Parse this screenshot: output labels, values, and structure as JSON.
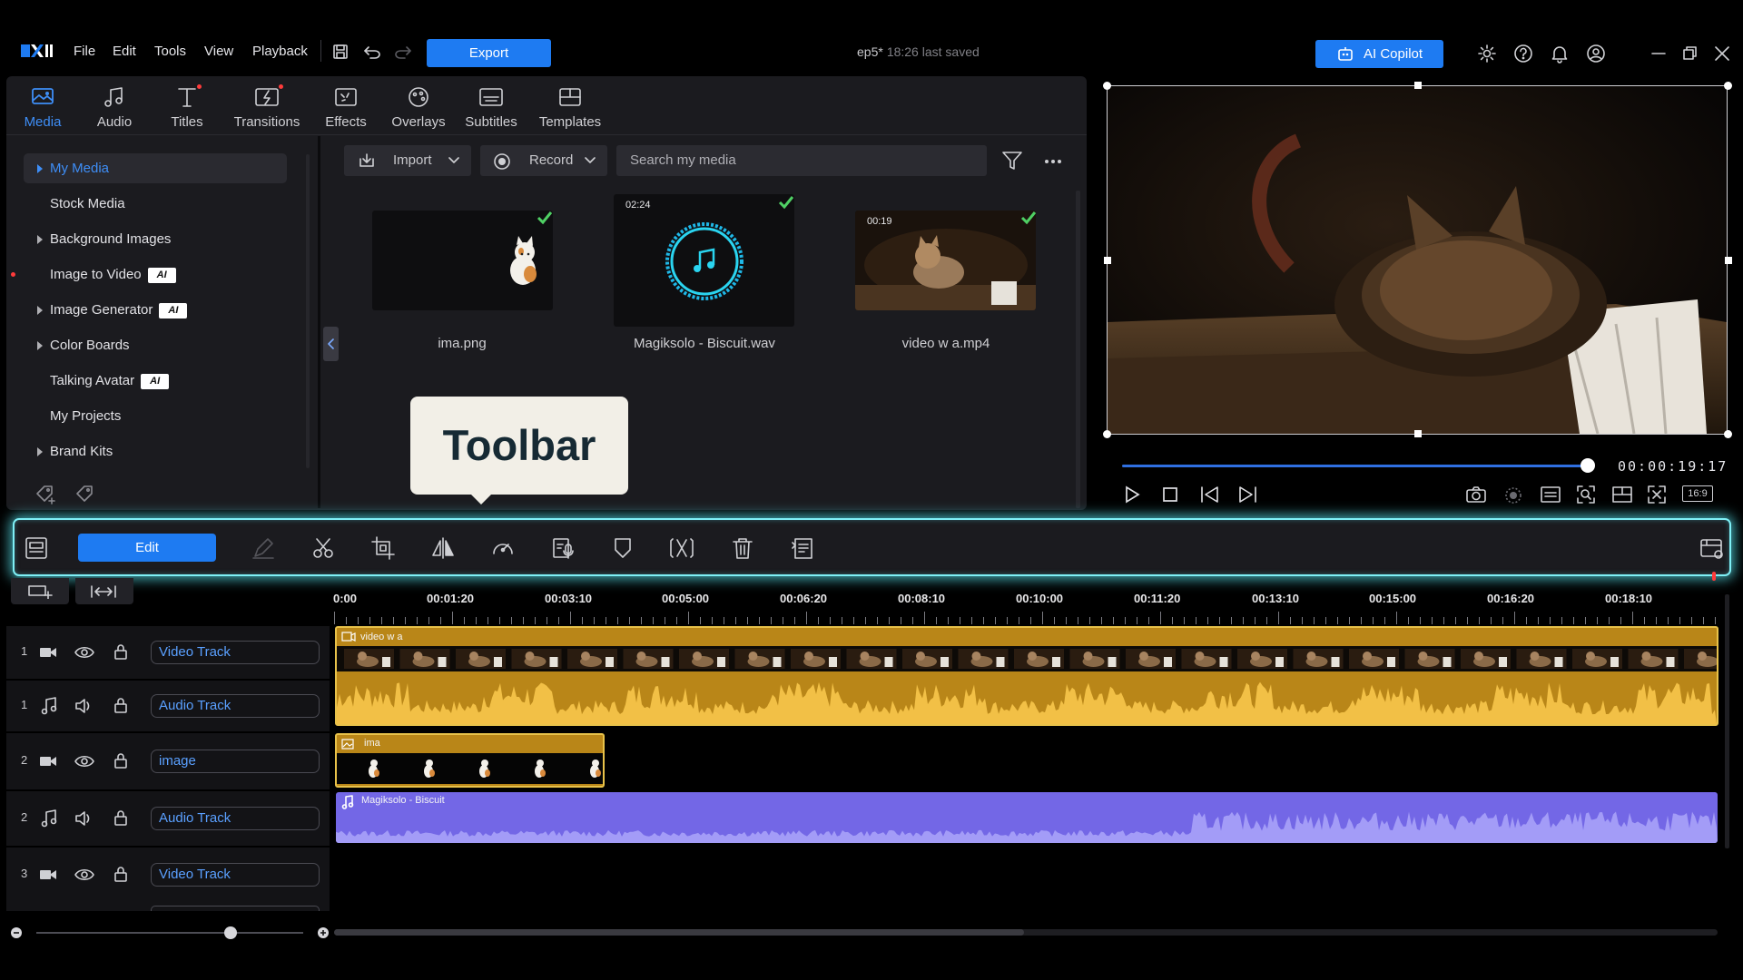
{
  "menu": [
    "File",
    "Edit",
    "Tools",
    "View",
    "Playback"
  ],
  "export_label": "Export",
  "doc": {
    "name": "ep5*",
    "saved": "18:26 last saved"
  },
  "copilot_label": "AI Copilot",
  "tabs": [
    {
      "label": "Media",
      "icon": "media-icon",
      "active": true
    },
    {
      "label": "Audio",
      "icon": "music-note-icon"
    },
    {
      "label": "Titles",
      "icon": "title-t-icon",
      "dot": true
    },
    {
      "label": "Transitions",
      "icon": "transition-icon",
      "dot": true
    },
    {
      "label": "Effects",
      "icon": "effects-icon"
    },
    {
      "label": "Overlays",
      "icon": "overlays-icon"
    },
    {
      "label": "Subtitles",
      "icon": "subtitles-icon"
    },
    {
      "label": "Templates",
      "icon": "templates-icon"
    }
  ],
  "sidebar": {
    "items": [
      {
        "label": "My Media",
        "arrow": true,
        "active": true
      },
      {
        "label": "Stock Media"
      },
      {
        "label": "Background Images",
        "arrow": true
      },
      {
        "label": "Image to Video",
        "ai": "AI",
        "dot": true
      },
      {
        "label": "Image Generator",
        "arrow": true,
        "ai": "AI"
      },
      {
        "label": "Color Boards",
        "arrow": true
      },
      {
        "label": "Talking Avatar",
        "ai": "AI"
      },
      {
        "label": "My Projects"
      },
      {
        "label": "Brand Kits",
        "arrow": true
      }
    ]
  },
  "library": {
    "import_label": "Import",
    "record_label": "Record",
    "search_placeholder": "Search my media",
    "items": [
      {
        "name": "ima.png",
        "duration": ""
      },
      {
        "name": "Magiksolo - Biscuit.wav",
        "duration": "02:24"
      },
      {
        "name": "video w a.mp4",
        "duration": "00:19"
      }
    ]
  },
  "tooltip": "Toolbar",
  "player": {
    "timecode": "00:00:19:17",
    "progress": 0.985,
    "aspect": "16:9"
  },
  "toolbar": {
    "edit_label": "Edit"
  },
  "ruler": [
    "0:00",
    "00:01:20",
    "00:03:10",
    "00:05:00",
    "00:06:20",
    "00:08:10",
    "00:10:00",
    "00:11:20",
    "00:13:10",
    "00:15:00",
    "00:16:20",
    "00:18:10"
  ],
  "tracks": [
    {
      "num": "1",
      "type": "video",
      "name": "Video Track"
    },
    {
      "num": "1",
      "type": "audio",
      "name": "Audio Track"
    },
    {
      "num": "2",
      "type": "video",
      "name": "image"
    },
    {
      "num": "2",
      "type": "audio",
      "name": "Audio Track"
    },
    {
      "num": "3",
      "type": "video",
      "name": "Video Track"
    }
  ],
  "clips": {
    "video1": "video w a",
    "image": "ima",
    "audio2": "Magiksolo - Biscuit"
  },
  "colors": {
    "accent": "#1e7bf2",
    "clip_gold": "#b98618",
    "clip_purple": "#7367e6",
    "toolbar_glow": "#7ff0f6"
  }
}
